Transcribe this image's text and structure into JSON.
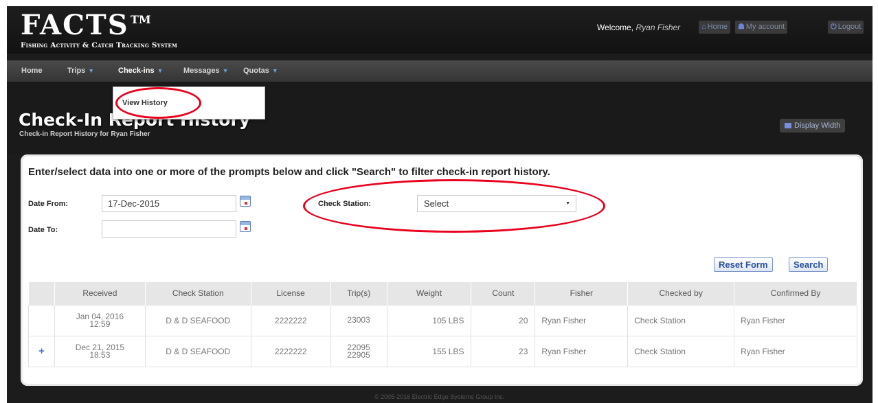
{
  "header": {
    "logo_main": "FACTS",
    "logo_tm": "TM",
    "logo_subtitle": "Fishing Activity & Catch Tracking System",
    "welcome_label": "Welcome,",
    "user_name": "Ryan Fisher",
    "home_link": "Home",
    "account_link": "My account",
    "logout_link": "Logout"
  },
  "nav": {
    "items": [
      {
        "label": "Home"
      },
      {
        "label": "Trips"
      },
      {
        "label": "Check-ins"
      },
      {
        "label": "Messages"
      },
      {
        "label": "Quotas"
      }
    ],
    "dropdown_item": "View History"
  },
  "page": {
    "title": "Check-In Report History",
    "subtitle": "Check-in Report History for Ryan Fisher",
    "display_width": "Display Width"
  },
  "filters": {
    "instructions": "Enter/select data into one or more of the prompts below and click \"Search\" to filter check-in report history.",
    "date_from_label": "Date From:",
    "date_from_value": "17-Dec-2015",
    "date_to_label": "Date To:",
    "date_to_value": "",
    "check_station_label": "Check Station:",
    "check_station_value": "Select",
    "reset_label": "Reset Form",
    "search_label": "Search"
  },
  "table": {
    "columns": [
      "",
      "Received",
      "Check Station",
      "License",
      "Trip(s)",
      "Weight",
      "Count",
      "Fisher",
      "Checked by",
      "Confirmed By"
    ],
    "rows": [
      {
        "expand": "",
        "received_date": "Jan 04, 2016",
        "received_time": "12:59",
        "check_station": "D & D SEAFOOD",
        "license": "2222222",
        "trip1": "23003",
        "trip2": "",
        "weight": "105 LBS",
        "count": "20",
        "fisher": "Ryan Fisher",
        "checked_by": "Check Station",
        "confirmed_by": "Ryan Fisher"
      },
      {
        "expand": "+",
        "received_date": "Dec 21, 2015",
        "received_time": "18:53",
        "check_station": "D & D SEAFOOD",
        "license": "2222222",
        "trip1": "22095",
        "trip2": "22905",
        "weight": "155 LBS",
        "count": "23",
        "fisher": "Ryan Fisher",
        "checked_by": "Check Station",
        "confirmed_by": "Ryan Fisher"
      }
    ]
  },
  "footer": {
    "text": "© 2005-2016 Electric Edge Systems Group Inc."
  },
  "annotations": {
    "ring_color": "#e8001c"
  }
}
